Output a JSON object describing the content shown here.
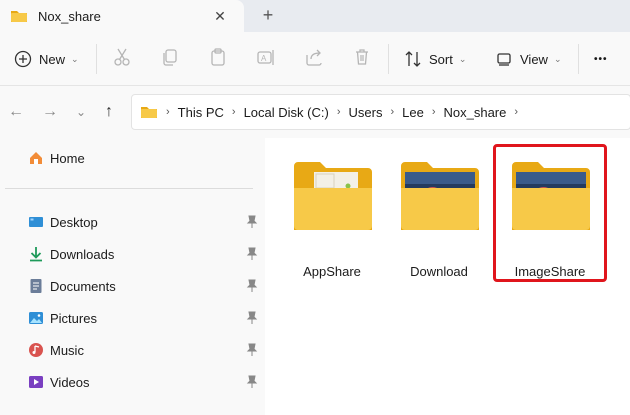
{
  "tab": {
    "title": "Nox_share",
    "close_icon": "close-icon",
    "new_tab_icon": "plus-icon"
  },
  "toolbar": {
    "new_label": "New",
    "sort_label": "Sort",
    "view_label": "View",
    "more_label": "•••",
    "icons": [
      "cut-icon",
      "copy-icon",
      "paste-icon",
      "rename-icon",
      "share-icon",
      "delete-icon"
    ]
  },
  "address": {
    "crumbs": [
      "This PC",
      "Local Disk (C:)",
      "Users",
      "Lee",
      "Nox_share"
    ]
  },
  "sidebar": {
    "home": "Home",
    "items": [
      {
        "label": "Desktop",
        "icon": "desktop-icon"
      },
      {
        "label": "Downloads",
        "icon": "download-icon"
      },
      {
        "label": "Documents",
        "icon": "documents-icon"
      },
      {
        "label": "Pictures",
        "icon": "pictures-icon"
      },
      {
        "label": "Music",
        "icon": "music-icon"
      },
      {
        "label": "Videos",
        "icon": "videos-icon"
      }
    ]
  },
  "folders": [
    {
      "name": "AppShare"
    },
    {
      "name": "Download"
    },
    {
      "name": "ImageShare"
    }
  ],
  "colors": {
    "folder": "#f7c948",
    "folder_back": "#e8a915",
    "highlight": "#e0151c"
  }
}
